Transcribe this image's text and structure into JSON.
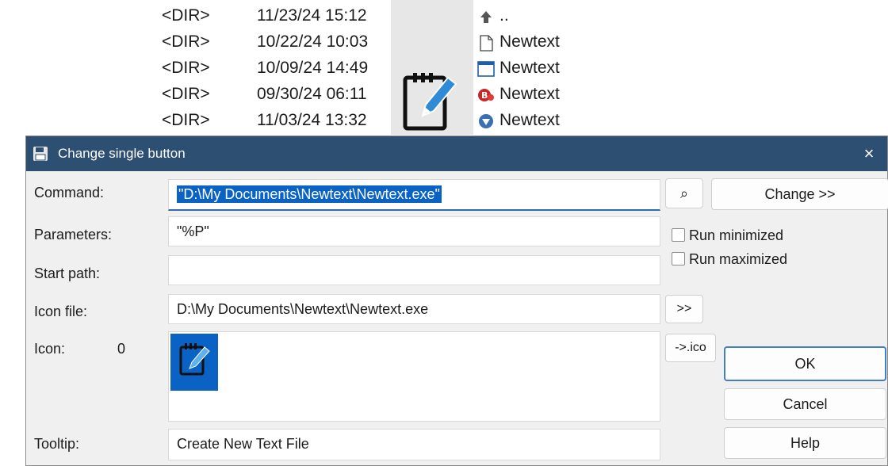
{
  "file_list": {
    "rows": [
      {
        "type": "<DIR>",
        "date": "11/23/24 15:12",
        "name": "..",
        "icon": "up-folder-icon"
      },
      {
        "type": "<DIR>",
        "date": "10/22/24 10:03",
        "name": "Newtext",
        "icon": "blank-page-icon"
      },
      {
        "type": "<DIR>",
        "date": "10/09/24 14:49",
        "name": "Newtext",
        "icon": "window-icon"
      },
      {
        "type": "<DIR>",
        "date": "09/30/24 06:11",
        "name": "Newtext",
        "icon": "red-badge-icon"
      },
      {
        "type": "<DIR>",
        "date": "11/03/24 13:32",
        "name": "Newtext",
        "icon": "blue-shield-icon"
      }
    ]
  },
  "dialog": {
    "title": "Change single button",
    "close_glyph": "×",
    "command": {
      "label": "Command:",
      "value": "\"D:\\My Documents\\Newtext\\Newtext.exe\""
    },
    "parameters": {
      "label": "Parameters:",
      "value": "\"%P\""
    },
    "start_path": {
      "label": "Start path:",
      "value": ""
    },
    "icon_file": {
      "label": "Icon file:",
      "value": "D:\\My Documents\\Newtext\\Newtext.exe"
    },
    "icon": {
      "label": "Icon:",
      "index": "0"
    },
    "tooltip": {
      "label": "Tooltip:",
      "value": "Create New Text File"
    },
    "buttons": {
      "browse_glyph": "⌕",
      "change": "Change >>",
      "icon_browse": ">>",
      "to_ico": "->.ico",
      "ok": "OK",
      "cancel": "Cancel",
      "help": "Help"
    },
    "checkboxes": {
      "run_minimized": "Run minimized",
      "run_maximized": "Run maximized"
    }
  },
  "colors": {
    "titlebar": "#2d4f72",
    "selection": "#0a62c4",
    "accent_border": "#3f7fc2"
  }
}
